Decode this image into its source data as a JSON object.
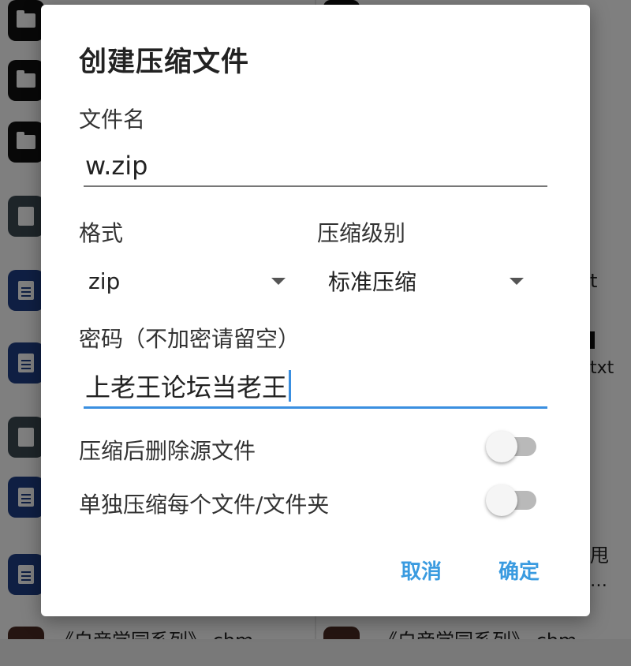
{
  "background": {
    "bottom_left_item": "《白帝学园系列》.chm",
    "bottom_right_item": "《白帝学园系列》.chm",
    "right_fragments": [
      "t",
      "txt",
      "甩",
      "…"
    ]
  },
  "dialog": {
    "title": "创建压缩文件",
    "filename_label": "文件名",
    "filename_value": "w.zip",
    "format_label": "格式",
    "format_value": "zip",
    "level_label": "压缩级别",
    "level_value": "标准压缩",
    "password_label": "密码（不加密请留空）",
    "password_value": "上老王论坛当老王",
    "delete_source_label": "压缩后删除源文件",
    "delete_source_on": false,
    "separate_label": "单独压缩每个文件/文件夹",
    "separate_on": false,
    "cancel_label": "取消",
    "ok_label": "确定"
  },
  "colors": {
    "accent": "#3a9be0",
    "scrim": "#00000080"
  }
}
